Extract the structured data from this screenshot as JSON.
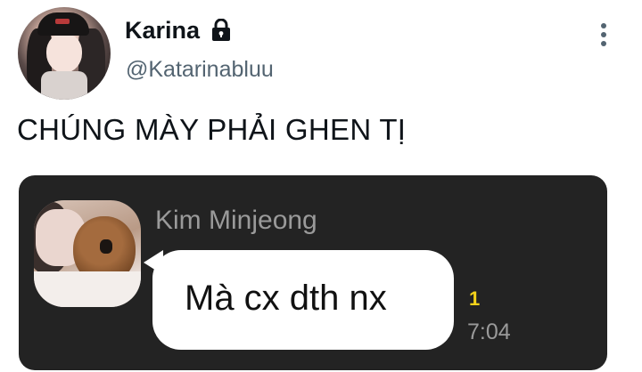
{
  "user": {
    "display_name": "Karina",
    "handle": "@Katarinabluu"
  },
  "tweet": {
    "text": "CHÚNG MÀY PHẢI GHEN TỊ"
  },
  "chat": {
    "sender": "Kim Minjeong",
    "message": "Mà cx dth nx",
    "unread_count": "1",
    "time": "7:04"
  },
  "icons": {
    "lock": "lock-icon",
    "more": "more-vertical-icon"
  },
  "colors": {
    "text_primary": "#0f1419",
    "text_secondary": "#536471",
    "media_bg": "#232323",
    "bubble": "#ffffff",
    "unread": "#f4d21a"
  }
}
